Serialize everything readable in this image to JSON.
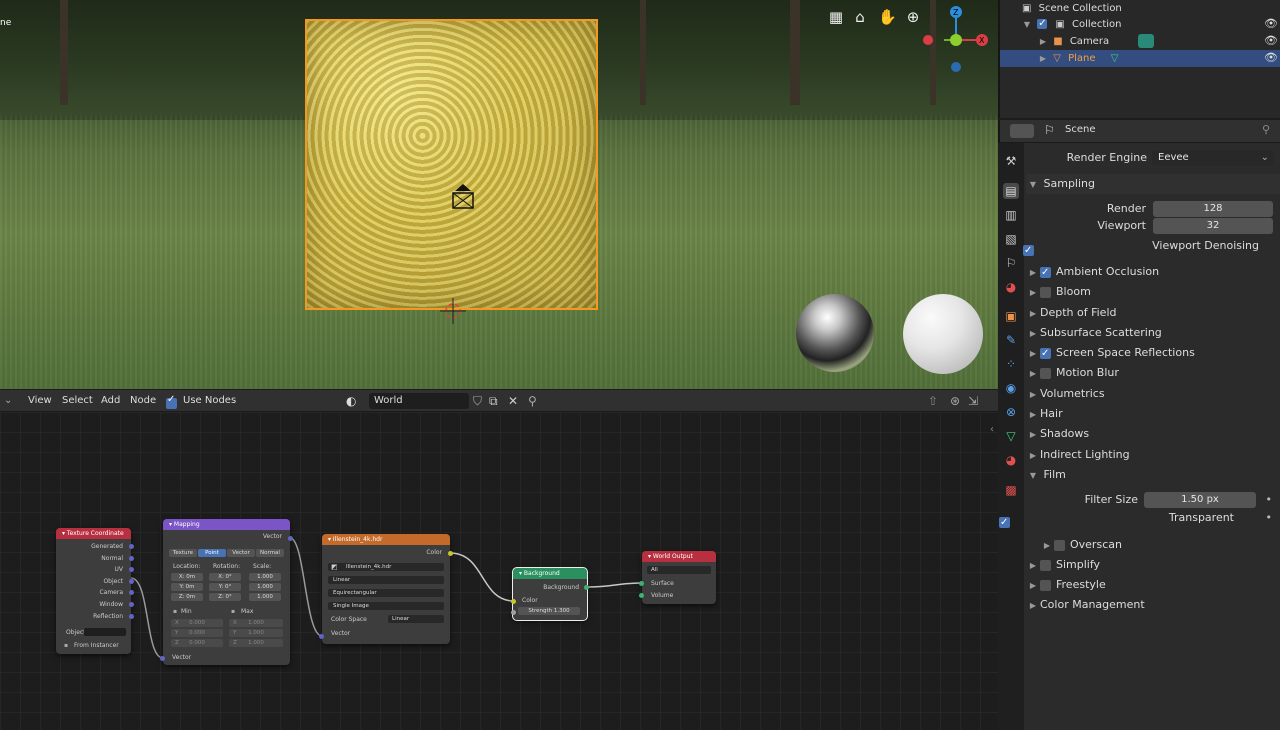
{
  "viewport": {
    "corner_text": "ne",
    "nav_icons": [
      "grid-icon",
      "camera-view-icon",
      "hand-pan-icon",
      "zoom-icon"
    ],
    "gizmo": {
      "z": "Z",
      "x": "X"
    }
  },
  "outliner": {
    "root": "Scene Collection",
    "collection": "Collection",
    "camera": "Camera",
    "plane": "Plane"
  },
  "properties": {
    "header_title": "Scene",
    "render_engine_label": "Render Engine",
    "render_engine_value": "Eevee",
    "sampling": "Sampling",
    "render_label": "Render",
    "render_value": "128",
    "viewport_label": "Viewport",
    "viewport_value": "32",
    "viewport_denoising": "Viewport Denoising",
    "panels": [
      {
        "label": "Ambient Occlusion",
        "checkbox": true,
        "checked": true
      },
      {
        "label": "Bloom",
        "checkbox": true,
        "checked": false
      },
      {
        "label": "Depth of Field",
        "checkbox": false
      },
      {
        "label": "Subsurface Scattering",
        "checkbox": false
      },
      {
        "label": "Screen Space Reflections",
        "checkbox": true,
        "checked": true
      },
      {
        "label": "Motion Blur",
        "checkbox": true,
        "checked": false
      },
      {
        "label": "Volumetrics",
        "checkbox": false
      },
      {
        "label": "Hair",
        "checkbox": false
      },
      {
        "label": "Shadows",
        "checkbox": false
      },
      {
        "label": "Indirect Lighting",
        "checkbox": false
      }
    ],
    "film": "Film",
    "filter_size_label": "Filter Size",
    "filter_size_value": "1.50 px",
    "transparent": "Transparent",
    "overscan": "Overscan",
    "simplify": "Simplify",
    "freestyle": "Freestyle",
    "color_management": "Color Management"
  },
  "node_editor": {
    "menus": [
      "View",
      "Select",
      "Add",
      "Node"
    ],
    "use_nodes": "Use Nodes",
    "world_name": "World",
    "nodes": {
      "texcoord": {
        "title": "Texture Coordinate",
        "outputs": [
          "Generated",
          "Normal",
          "UV",
          "Object",
          "Camera",
          "Window",
          "Reflection"
        ],
        "object_label": "Object",
        "from_instancer": "From Instancer"
      },
      "mapping": {
        "title": "Mapping",
        "vector_out": "Vector",
        "tabs": [
          "Texture",
          "Point",
          "Vector",
          "Normal"
        ],
        "location": "Location:",
        "rotation": "Rotation:",
        "scale": "Scale:",
        "loc": [
          "X: 0m",
          "Y: 0m",
          "Z: 0m"
        ],
        "rot": [
          "X: 0°",
          "Y: 0°",
          "Z: 0°"
        ],
        "scl": [
          "1.000",
          "1.000",
          "1.000"
        ],
        "min": "Min",
        "max": "Max",
        "min_vals": [
          "0.000",
          "0.000",
          "0.000"
        ],
        "max_vals": [
          "1.000",
          "1.000",
          "1.000"
        ],
        "min_axes": [
          "X",
          "Y",
          "Z"
        ],
        "vector_in": "Vector"
      },
      "envtex": {
        "title": "Illenstein_4k.hdr",
        "color_out": "Color",
        "image": "Illenstein_4k.hdr",
        "interp": "Linear",
        "proj": "Equirectangular",
        "source": "Single Image",
        "cs_label": "Color Space",
        "cs_value": "Linear",
        "vector_in": "Vector"
      },
      "background": {
        "title": "Background",
        "out": "Background",
        "color": "Color",
        "strength_label": "Strength",
        "strength_value": "1.300"
      },
      "world_output": {
        "title": "World Output",
        "target": "All",
        "surface": "Surface",
        "volume": "Volume"
      }
    }
  },
  "colors": {
    "selection": "#334d80",
    "accent_blue": "#4772b3",
    "plane_outline": "#f29a1f"
  }
}
